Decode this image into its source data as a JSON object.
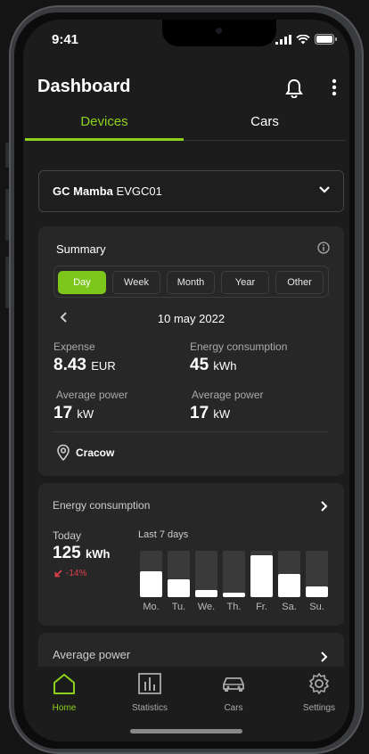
{
  "status_bar": {
    "time": "9:41"
  },
  "header": {
    "title": "Dashboard"
  },
  "tabs": [
    {
      "label": "Devices",
      "active": true
    },
    {
      "label": "Cars",
      "active": false
    }
  ],
  "device": {
    "brand": "GC Mamba",
    "model": "EVGC01"
  },
  "summary": {
    "title": "Summary",
    "periods": [
      {
        "label": "Day",
        "active": true
      },
      {
        "label": "Week",
        "active": false
      },
      {
        "label": "Month",
        "active": false
      },
      {
        "label": "Year",
        "active": false
      },
      {
        "label": "Other",
        "active": false
      }
    ],
    "date": "10 may 2022",
    "expense": {
      "label": "Expense",
      "value": "8.43",
      "unit": "EUR"
    },
    "energy": {
      "label": "Energy consumption",
      "value": "45",
      "unit": "kWh"
    },
    "avg_power_1": {
      "label": "Average power",
      "value": "17",
      "unit": "kW"
    },
    "avg_power_2": {
      "label": "Average power",
      "value": "17",
      "unit": "kW"
    },
    "location": "Cracow"
  },
  "energy_card": {
    "title": "Energy consumption",
    "today_label": "Today",
    "today_value": "125",
    "today_unit": "kWh",
    "change": "-14%",
    "week_label": "Last 7 days",
    "days": [
      {
        "label": "Mo.",
        "level": 0.55
      },
      {
        "label": "Tu.",
        "level": 0.38
      },
      {
        "label": "We.",
        "level": 0.15
      },
      {
        "label": "Th.",
        "level": 0.1
      },
      {
        "label": "Fr.",
        "level": 0.9
      },
      {
        "label": "Sa.",
        "level": 0.5
      },
      {
        "label": "Su.",
        "level": 0.24
      }
    ]
  },
  "avg_power_card": {
    "title": "Average power"
  },
  "bottom_nav": [
    {
      "label": "Home",
      "icon": "home-icon",
      "active": true
    },
    {
      "label": "Statistics",
      "icon": "statistics-icon",
      "active": false
    },
    {
      "label": "Cars",
      "icon": "car-icon",
      "active": false
    },
    {
      "label": "Settings",
      "icon": "settings-icon",
      "active": false
    }
  ],
  "colors": {
    "accent": "#8ED11D",
    "background": "#1C1C1C",
    "card": "#272727",
    "negative": "#E0414A"
  }
}
